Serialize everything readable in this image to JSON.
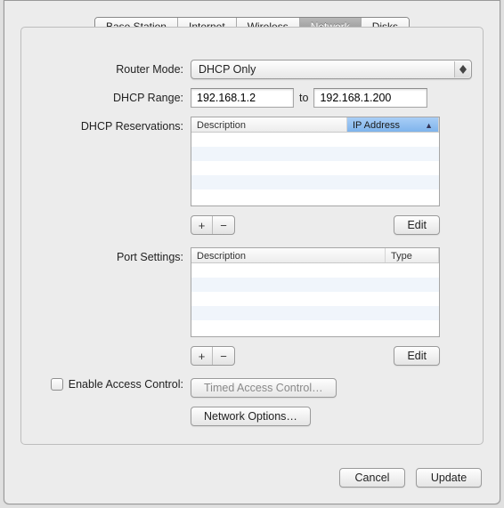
{
  "tabs": {
    "items": [
      "Base Station",
      "Internet",
      "Wireless",
      "Network",
      "Disks"
    ],
    "active_index": 3
  },
  "form": {
    "router_mode": {
      "label": "Router Mode:",
      "value": "DHCP Only"
    },
    "dhcp_range": {
      "label": "DHCP Range:",
      "start": "192.168.1.2",
      "to": "to",
      "end": "192.168.1.200"
    },
    "dhcp_reservations": {
      "label": "DHCP Reservations:",
      "columns": [
        "Description",
        "IP Address"
      ],
      "sorted_column_index": 1,
      "rows": [],
      "add": "+",
      "remove": "−",
      "edit": "Edit"
    },
    "port_settings": {
      "label": "Port Settings:",
      "columns": [
        "Description",
        "Type"
      ],
      "rows": [],
      "add": "+",
      "remove": "−",
      "edit": "Edit"
    },
    "access_control": {
      "checkbox_label": "Enable Access Control:",
      "checked": false,
      "button": "Timed Access Control…"
    },
    "network_options": {
      "button": "Network Options…"
    }
  },
  "footer": {
    "cancel": "Cancel",
    "update": "Update"
  }
}
